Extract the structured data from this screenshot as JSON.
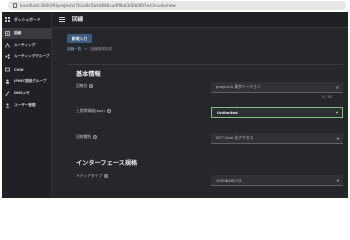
{
  "browser": {
    "url": "localhost:3000/#/projects/7b1a9c5b4d684ca4f9bd3d2b0f07e/circuits/new"
  },
  "sidebar": {
    "items": [
      {
        "label": "ダッシュボード",
        "icon": "dashboard-icon"
      },
      {
        "label": "回線",
        "icon": "circuit-icon"
      },
      {
        "label": "ルーティング",
        "icon": "routing-icon"
      },
      {
        "label": "ルーティンググループ",
        "icon": "routing-group-icon"
      },
      {
        "label": "CGW",
        "icon": "gateway-icon"
      },
      {
        "label": "JPNIC登録グループ",
        "icon": "registry-icon"
      },
      {
        "label": "DNSメモ",
        "icon": "dns-icon"
      },
      {
        "label": "ユーザー管理",
        "icon": "user-icon"
      }
    ]
  },
  "header": {
    "title": "回線"
  },
  "toolbar": {
    "new_button": "新規入力"
  },
  "breadcrumb": {
    "link": "回線一覧",
    "separator": ">",
    "current": "回線新規作成"
  },
  "form": {
    "basic_section": "基本情報",
    "circuit_name_label": "回線名",
    "circuit_name_value": "project-A 東京リージョン",
    "circuit_name_counter": "0 / 40",
    "bandwidth_label": "上限帯域幅(bps)",
    "bandwidth_value": "Unlimited",
    "type_label": "回線種別",
    "type_value": "NTT Com 光アクセス",
    "interface_section": "インターフェース規格",
    "media_label": "メディアタイプ",
    "media_value": "1000BASE-TX"
  },
  "colors": {
    "background": "#26272b",
    "sidebar": "#202124",
    "accent_button": "#3d5a80",
    "focus_border": "#7fbf7f",
    "link": "#8ab4f8"
  }
}
